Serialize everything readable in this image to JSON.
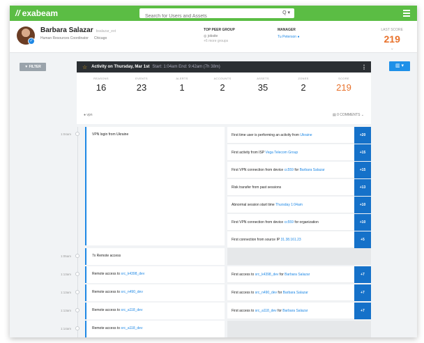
{
  "header": {
    "logo_text": "exabeam",
    "search_placeholder": "Search for Users and Assets",
    "search_icon": "Q ▾"
  },
  "user": {
    "name": "Barbara Salazar",
    "username": "bsalazar_ext",
    "title": "Human Resources Coordinator",
    "location": "Chicago",
    "peer_group_label": "TOP PEER GROUP",
    "peer_group_value": "jobsite",
    "peer_group_more": "+6 more groups",
    "manager_label": "MANAGER",
    "manager_value": "Tu Peterson",
    "last_score_label": "LAST SCORE",
    "last_score_value": "219"
  },
  "toolbar": {
    "filter_label": "▼ FILTER",
    "chart_label": "▥ ▾"
  },
  "activity": {
    "title": "Activity on Thursday, Mar 1st",
    "time_range": "Start: 1:04am End: 9:42am (7h 38m)",
    "stats": [
      {
        "label": "REASONS",
        "value": "16"
      },
      {
        "label": "EVENTS",
        "value": "23"
      },
      {
        "label": "ALERTS",
        "value": "1"
      },
      {
        "label": "ACCOUNTS",
        "value": "2"
      },
      {
        "label": "ASSETS",
        "value": "35"
      },
      {
        "label": "ZONES",
        "value": "2"
      },
      {
        "label": "SCORE",
        "value": "219"
      }
    ],
    "vpn_label": "vpn",
    "comments_label": "0 COMMENTS ⌄"
  },
  "timeline": {
    "times": [
      "1:04am",
      "1:05am",
      "1:13am",
      "1:13am",
      "1:13am",
      "1:14am"
    ],
    "events": [
      {
        "pre": "VPN login from Ukraine",
        "link": "",
        "post": ""
      },
      {
        "pre": "7x Remote access",
        "link": "",
        "post": ""
      },
      {
        "pre": "Remote access to ",
        "link": "src_k4398_dev",
        "post": ""
      },
      {
        "pre": "Remote access to ",
        "link": "src_n490_dev",
        "post": ""
      },
      {
        "pre": "Remote access to ",
        "link": "src_a118_dev",
        "post": ""
      },
      {
        "pre": "Remote access to ",
        "link": "src_a118_dev",
        "post": ""
      }
    ],
    "reasons": [
      {
        "pre": "First time user is performing an activity from ",
        "link": "Ukraine",
        "mid": "",
        "link2": "",
        "post": "",
        "points": "+20"
      },
      {
        "pre": "First activity from ISP ",
        "link": "Vega Telecom Group",
        "mid": "",
        "link2": "",
        "post": "",
        "points": "+15"
      },
      {
        "pre": "First VPN connection from device ",
        "link": "cc559",
        "mid": " for ",
        "link2": "Barbara Salazar",
        "post": "",
        "points": "+15"
      },
      {
        "pre": "Risk transfer from past sessions",
        "link": "",
        "mid": "",
        "link2": "",
        "post": "",
        "points": "+13"
      },
      {
        "pre": "Abnormal session start time ",
        "link": "Thursday 1:04am",
        "mid": "",
        "link2": "",
        "post": "",
        "points": "+10"
      },
      {
        "pre": "First VPN connection from device ",
        "link": "cc559",
        "mid": "",
        "link2": "",
        "post": " for organization",
        "points": "+10"
      },
      {
        "pre": "First connection from source IP ",
        "link": "31.38.161.23",
        "mid": "",
        "link2": "",
        "post": "",
        "points": "+5"
      },
      {
        "pre": "First access to ",
        "link": "src_k4398_dev",
        "mid": " for ",
        "link2": "Barbara Salazar",
        "post": "",
        "points": "+7"
      },
      {
        "pre": "First access to ",
        "link": "src_n490_dev",
        "mid": " for ",
        "link2": "Barbara Salazar",
        "post": "",
        "points": "+7"
      },
      {
        "pre": "First access to ",
        "link": "src_a118_dev",
        "mid": " for ",
        "link2": "Barbara Salazar",
        "post": "",
        "points": "+7"
      }
    ]
  }
}
